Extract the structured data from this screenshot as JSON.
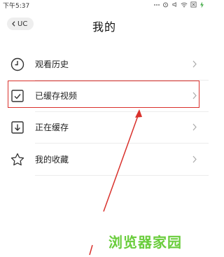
{
  "status_bar": {
    "time": "下午5:37"
  },
  "header": {
    "back_label": "UC",
    "title": "我的"
  },
  "menu": [
    {
      "label": "观看历史",
      "icon": "clock-icon"
    },
    {
      "label": "已缓存视频",
      "icon": "cached-video-icon"
    },
    {
      "label": "正在缓存",
      "icon": "download-icon"
    },
    {
      "label": "我的收藏",
      "icon": "star-icon"
    }
  ],
  "annotation": {
    "color": "#d9312c"
  },
  "watermark": {
    "text": "浏览器家园",
    "color": "#6acd3c"
  }
}
